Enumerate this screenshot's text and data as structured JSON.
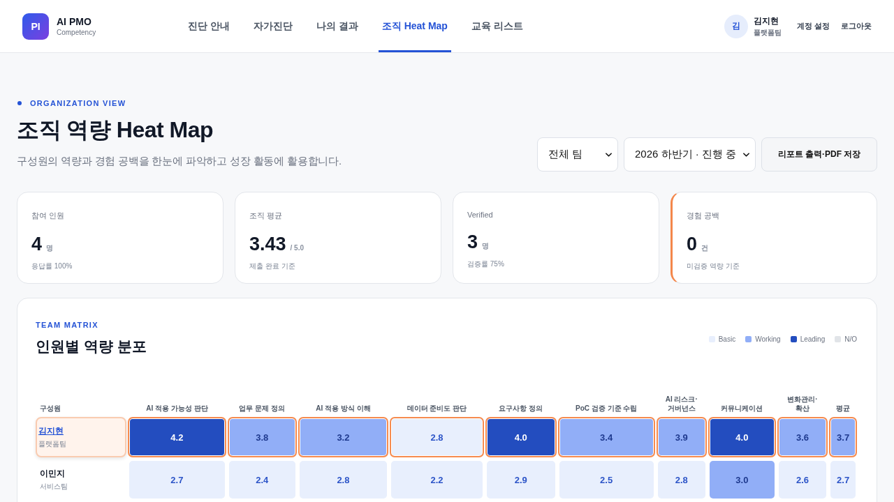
{
  "header": {
    "logo": {
      "mark": "PI",
      "title": "AI PMO",
      "subtitle": "Competency"
    },
    "nav": [
      {
        "label": "진단 안내",
        "selected": false
      },
      {
        "label": "자가진단",
        "selected": false
      },
      {
        "label": "나의 결과",
        "selected": false
      },
      {
        "label": "조직 Heat Map",
        "selected": true
      },
      {
        "label": "교육 리스트",
        "selected": false
      }
    ],
    "user": {
      "initial": "김",
      "name": "김지현",
      "team": "플랫폼팀"
    },
    "links": [
      "계정 설정",
      "로그아웃"
    ]
  },
  "page": {
    "eyebrow": "ORGANIZATION VIEW",
    "title": "조직 역량 Heat Map",
    "subtitle": "구성원의 역량과 경험 공백을 한눈에 파악하고 성장 활동에 활용합니다.",
    "filters": [
      {
        "value": "전체 팀"
      },
      {
        "value": "2026 하반기 · 진행 중"
      }
    ],
    "action": "리포트 출력·PDF 저장"
  },
  "stats": [
    {
      "label": "참여 인원",
      "value": "4",
      "unit": "명",
      "note": "응답률 100%",
      "flagged": false
    },
    {
      "label": "조직 평균",
      "value": "3.43",
      "unit": "/ 5.0",
      "note": "제출 완료 기준",
      "flagged": false
    },
    {
      "label": "Verified",
      "value": "3",
      "unit": "명",
      "note": "검증률 75%",
      "flagged": false
    },
    {
      "label": "경험 공백",
      "value": "0",
      "unit": "건",
      "note": "미검증 역량 기준",
      "flagged": true
    }
  ],
  "matrix": {
    "eyebrow": "TEAM MATRIX",
    "title": "인원별 역량 분포",
    "legend": [
      {
        "label": "Basic",
        "color": "#e8effd"
      },
      {
        "label": "Working",
        "color": "#91aef7"
      },
      {
        "label": "Leading",
        "color": "#234dbf"
      },
      {
        "label": "N/O",
        "color": "#e1e4e8"
      }
    ],
    "member_header": "구성원",
    "columns": [
      "AI 적용 가능성 판단",
      "업무 문제 정의",
      "AI 적용 방식 이해",
      "데이터 준비도 판단",
      "요구사항 정의",
      "PoC 검증 기준 수립",
      "AI 리스크·\n거버넌스",
      "커뮤니케이션",
      "변화관리·\n확산",
      "평균"
    ],
    "rows": [
      {
        "name": "김지현",
        "team": "플랫폼팀",
        "selected": true,
        "cells": [
          {
            "value": "4.2",
            "kind": "leading"
          },
          {
            "value": "3.8",
            "kind": "working"
          },
          {
            "value": "3.2",
            "kind": "working"
          },
          {
            "value": "2.8",
            "kind": "basic"
          },
          {
            "value": "4.0",
            "kind": "leading"
          },
          {
            "value": "3.4",
            "kind": "working"
          },
          {
            "value": "3.9",
            "kind": "working"
          },
          {
            "value": "4.0",
            "kind": "leading"
          },
          {
            "value": "3.6",
            "kind": "working"
          },
          {
            "value": "3.7",
            "kind": "working"
          }
        ]
      },
      {
        "name": "이민지",
        "team": "서비스팀",
        "selected": false,
        "cells": [
          {
            "value": "2.7",
            "kind": "basic"
          },
          {
            "value": "2.4",
            "kind": "basic"
          },
          {
            "value": "2.8",
            "kind": "basic"
          },
          {
            "value": "2.2",
            "kind": "basic"
          },
          {
            "value": "2.9",
            "kind": "basic"
          },
          {
            "value": "2.5",
            "kind": "basic"
          },
          {
            "value": "2.8",
            "kind": "basic"
          },
          {
            "value": "3.0",
            "kind": "working"
          },
          {
            "value": "2.6",
            "kind": "basic"
          },
          {
            "value": "2.7",
            "kind": "basic"
          }
        ]
      }
    ]
  }
}
